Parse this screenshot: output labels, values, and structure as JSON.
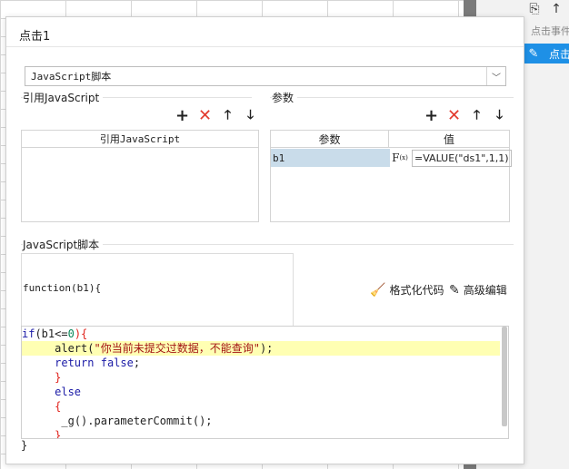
{
  "dialog": {
    "title": "点击1",
    "script_type": "JavaScript脚本"
  },
  "ref_js": {
    "section_label": "引用JavaScript",
    "column_header": "引用JavaScript"
  },
  "params": {
    "section_label": "参数",
    "col_name": "参数",
    "col_value": "值",
    "row": {
      "name": "b1",
      "fx": "F",
      "fx_sub": "(x)",
      "value": "=VALUE(\"ds1\",1,1)"
    }
  },
  "toolbar_icons": {
    "add": "plus-icon",
    "delete": "x-icon",
    "up": "arrow-up-icon",
    "down": "arrow-down-icon"
  },
  "script": {
    "section_label": "JavaScript脚本",
    "signature": "function(b1){",
    "format_label": "格式化代码",
    "advanced_label": "高级编辑",
    "closing": "}"
  },
  "code": {
    "l1": [
      "if",
      "(b1<=",
      "0",
      "){"
    ],
    "l2": [
      "alert",
      "(",
      "\"你当前未提交过数据，不能查询\"",
      ");"
    ],
    "l3": [
      "return",
      "false",
      ";"
    ],
    "l4": "}",
    "l5": "else",
    "l6": "{",
    "l7": [
      "_g",
      "().parameterCommit",
      "();"
    ],
    "l8": "}"
  },
  "right_panel": {
    "event_label": "点击事件",
    "selected_label": "点击"
  },
  "colors": {
    "accent": "#1e90e6",
    "highlight": "#ffffb3",
    "delete": "#e23b2e",
    "selected_cell": "#c9dcea"
  }
}
